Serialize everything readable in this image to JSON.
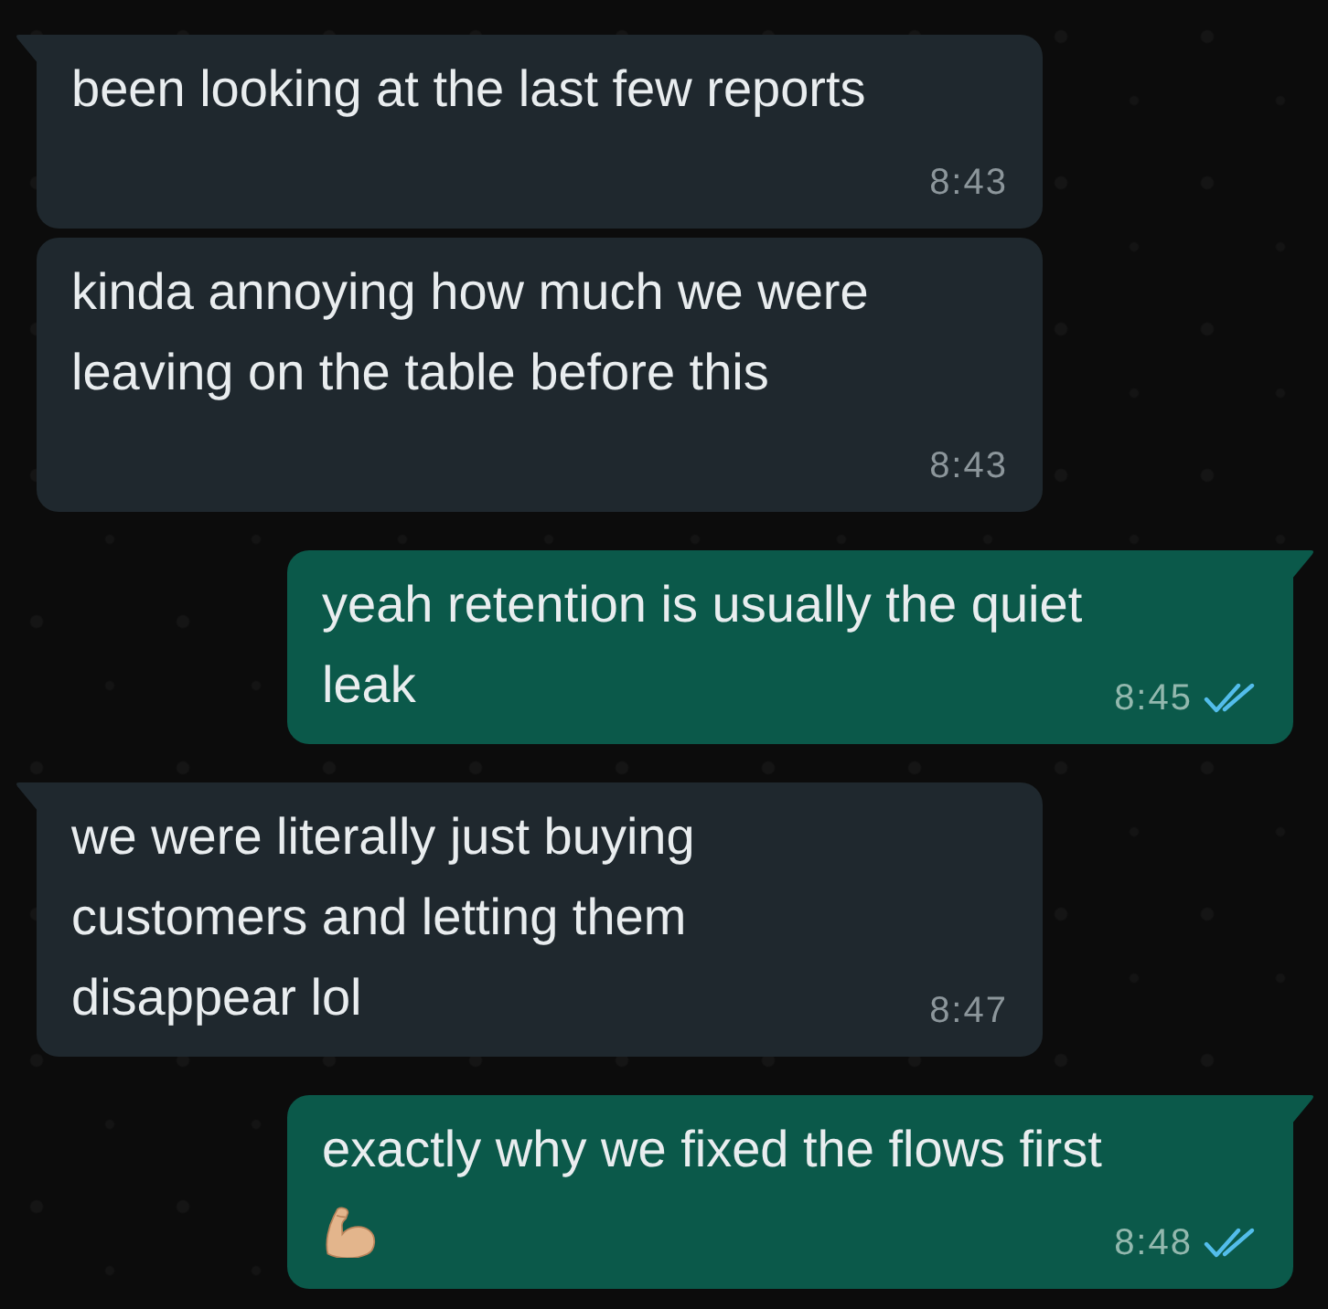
{
  "messages": [
    {
      "outgoing": false,
      "tail": true,
      "text": "been looking at the last few reports",
      "time": "8:43"
    },
    {
      "outgoing": false,
      "tail": false,
      "text": "kinda annoying how much we were leaving on the table before this",
      "time": "8:43"
    },
    {
      "outgoing": true,
      "tail": true,
      "text": "yeah retention is usually the quiet leak",
      "time": "8:45",
      "read": true
    },
    {
      "outgoing": false,
      "tail": true,
      "text": "we were literally just buying customers and letting them disappear lol",
      "time": "8:47"
    },
    {
      "outgoing": true,
      "tail": true,
      "text": "exactly why we fixed the flows first",
      "trailing_emoji": true,
      "time": "8:48",
      "read": true
    }
  ]
}
